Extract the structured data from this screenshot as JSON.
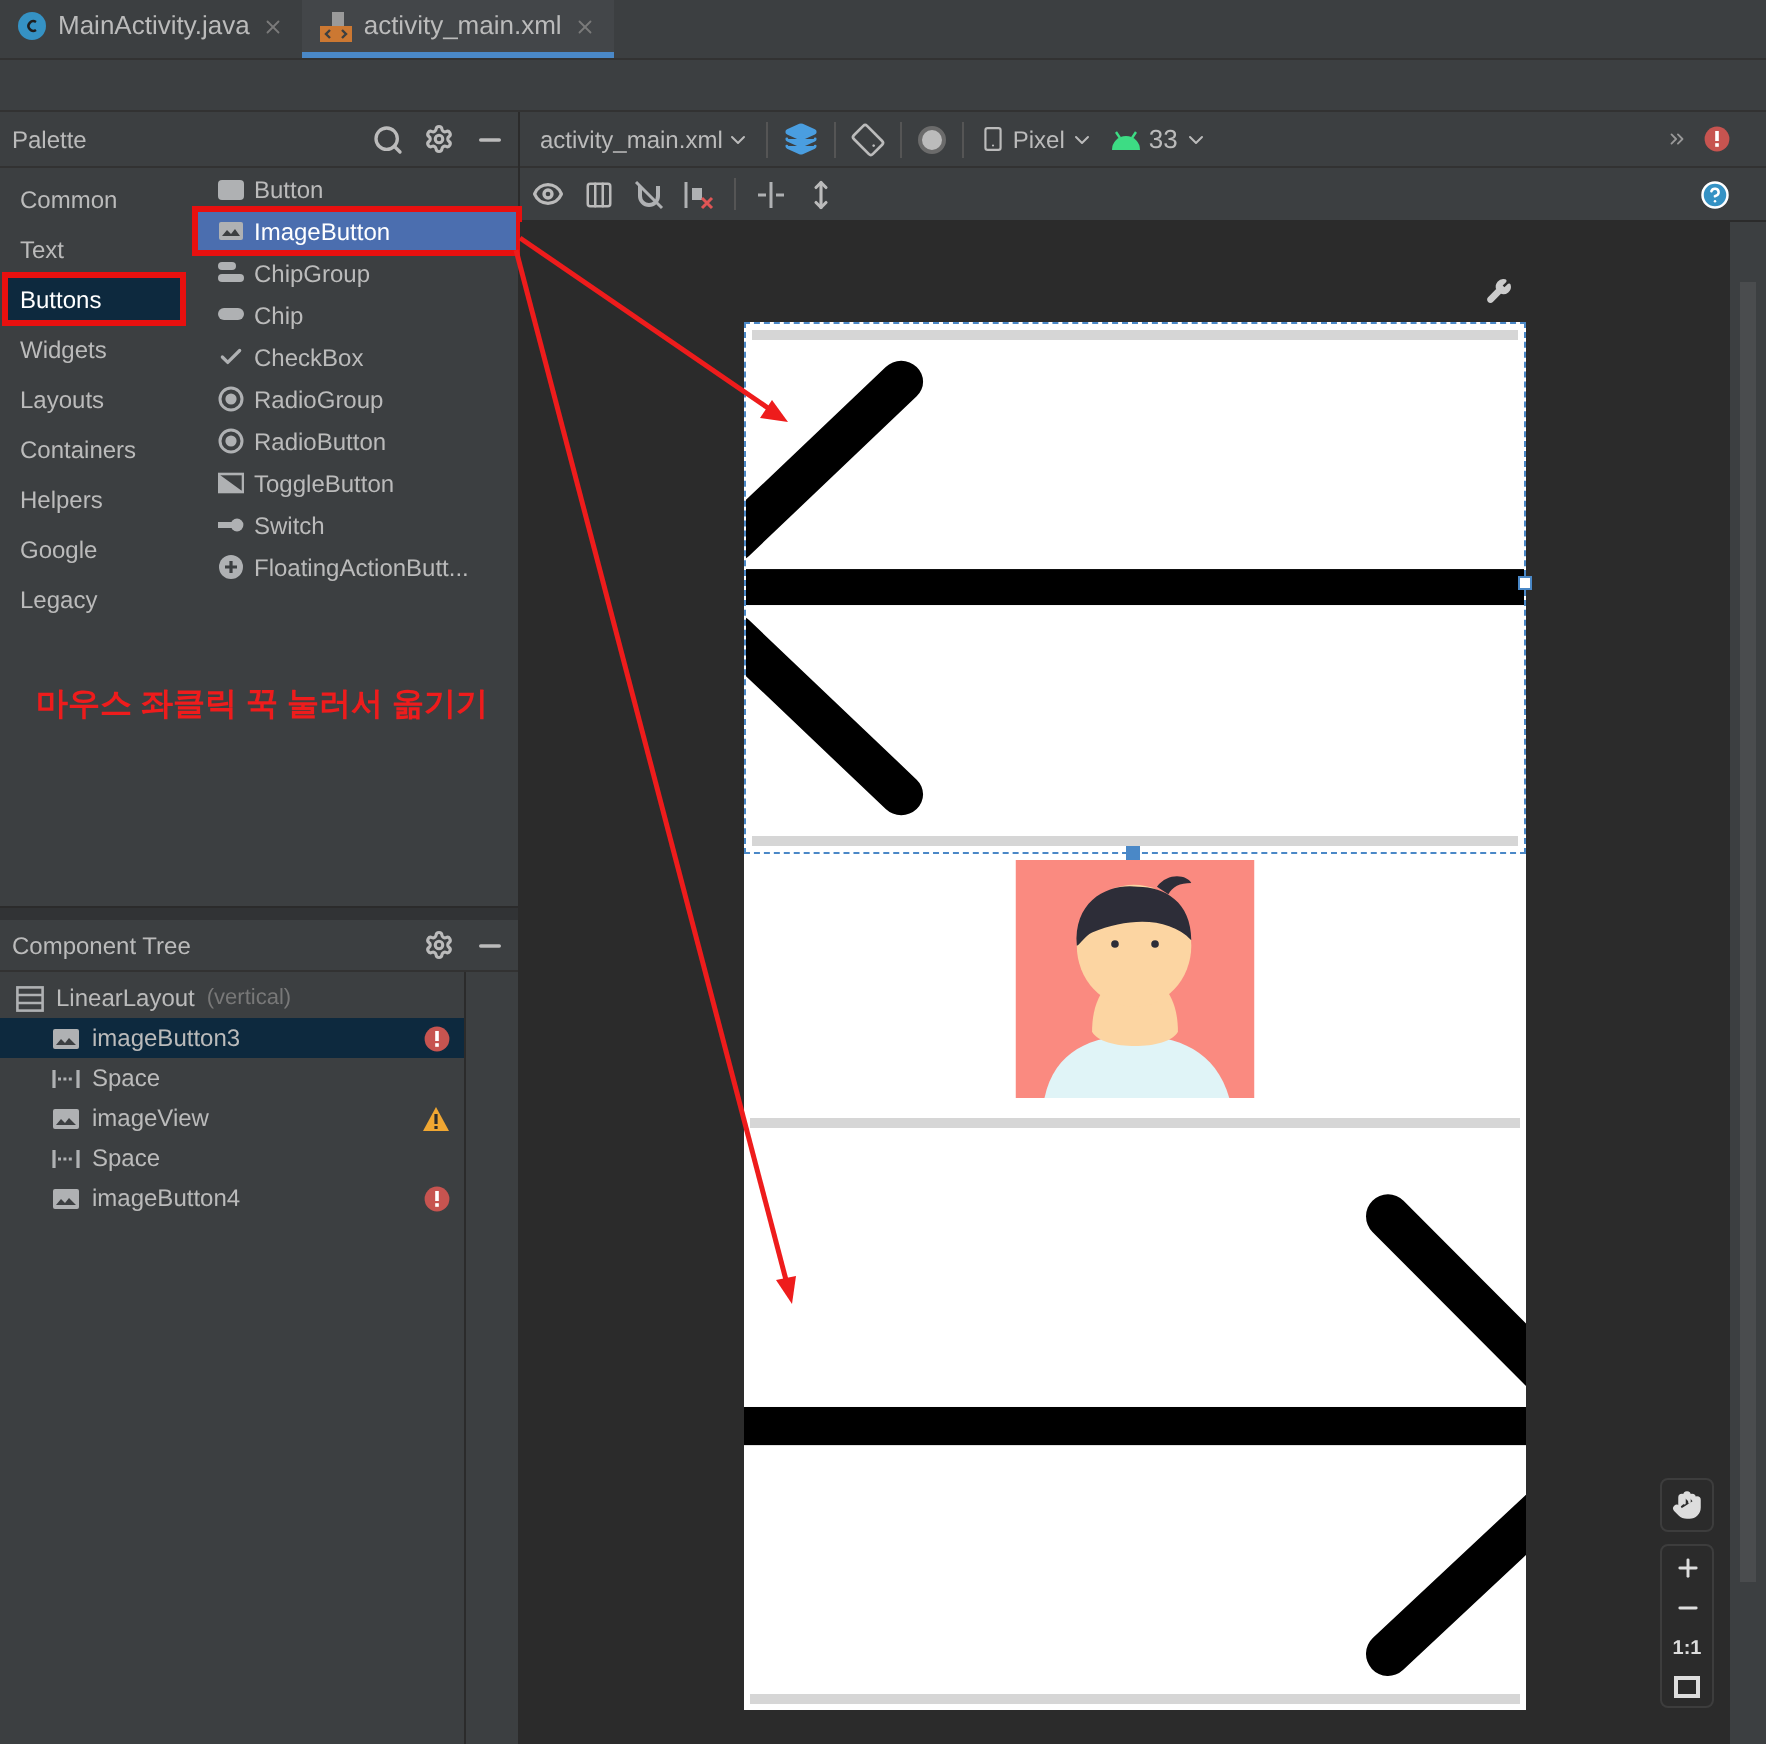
{
  "tabs": [
    {
      "label": "MainActivity.java",
      "kind": "java",
      "selected": false
    },
    {
      "label": "activity_main.xml",
      "kind": "xml",
      "selected": true
    }
  ],
  "palette": {
    "title": "Palette",
    "categories": [
      {
        "label": "Common",
        "selected": false,
        "annotated": false
      },
      {
        "label": "Text",
        "selected": false,
        "annotated": false
      },
      {
        "label": "Buttons",
        "selected": true,
        "annotated": true
      },
      {
        "label": "Widgets",
        "selected": false,
        "annotated": false
      },
      {
        "label": "Layouts",
        "selected": false,
        "annotated": false
      },
      {
        "label": "Containers",
        "selected": false,
        "annotated": false
      },
      {
        "label": "Helpers",
        "selected": false,
        "annotated": false
      },
      {
        "label": "Google",
        "selected": false,
        "annotated": false
      },
      {
        "label": "Legacy",
        "selected": false,
        "annotated": false
      }
    ],
    "items": [
      {
        "label": "Button",
        "kind": "button",
        "selected": false,
        "annotated": false
      },
      {
        "label": "ImageButton",
        "kind": "image",
        "selected": true,
        "annotated": true
      },
      {
        "label": "ChipGroup",
        "kind": "chipgroup",
        "selected": false,
        "annotated": false
      },
      {
        "label": "Chip",
        "kind": "chip",
        "selected": false,
        "annotated": false
      },
      {
        "label": "CheckBox",
        "kind": "check",
        "selected": false,
        "annotated": false
      },
      {
        "label": "RadioGroup",
        "kind": "radio",
        "selected": false,
        "annotated": false
      },
      {
        "label": "RadioButton",
        "kind": "radio",
        "selected": false,
        "annotated": false
      },
      {
        "label": "ToggleButton",
        "kind": "toggle",
        "selected": false,
        "annotated": false
      },
      {
        "label": "Switch",
        "kind": "switch",
        "selected": false,
        "annotated": false
      },
      {
        "label": "FloatingActionButt...",
        "kind": "fab",
        "selected": false,
        "annotated": false
      }
    ]
  },
  "annotation": {
    "text": "마우스 좌클릭 꾹 눌러서 옮기기"
  },
  "component_tree": {
    "title": "Component Tree",
    "root": {
      "label": "LinearLayout",
      "note": "(vertical)",
      "children": [
        {
          "label": "imageButton3",
          "kind": "image",
          "has_error": true,
          "has_warning": false,
          "selected": true
        },
        {
          "label": "Space",
          "kind": "space",
          "has_error": false,
          "has_warning": false,
          "selected": false
        },
        {
          "label": "imageView",
          "kind": "image",
          "has_error": false,
          "has_warning": true,
          "selected": false
        },
        {
          "label": "Space",
          "kind": "space",
          "has_error": false,
          "has_warning": false,
          "selected": false
        },
        {
          "label": "imageButton4",
          "kind": "image",
          "has_error": true,
          "has_warning": false,
          "selected": false
        }
      ]
    }
  },
  "design_toolbar": {
    "file": "activity_main.xml",
    "device": "Pixel",
    "api": "33"
  },
  "zoom_controls": {
    "actual_size": "1:1"
  }
}
